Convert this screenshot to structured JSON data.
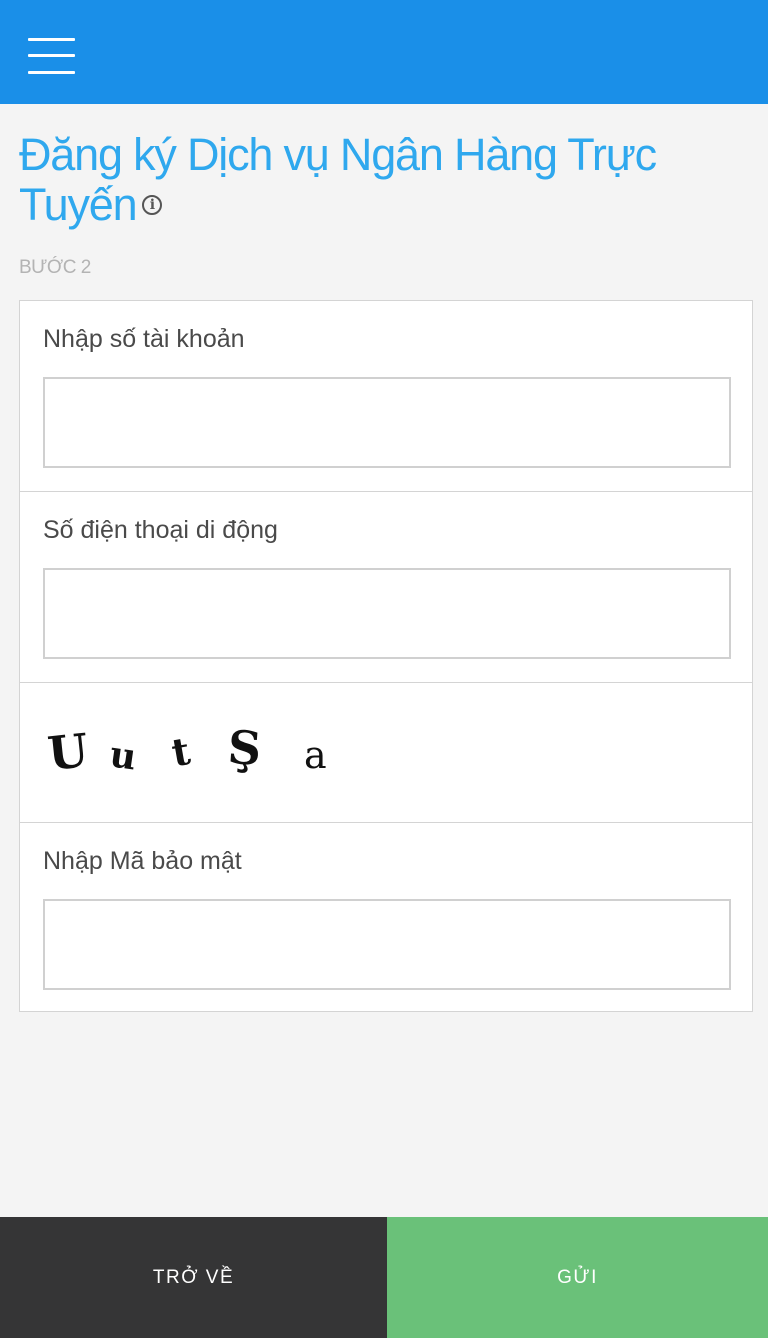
{
  "header": {
    "menu_icon": "hamburger-menu-icon",
    "bar_color": "#1a8fe8"
  },
  "page": {
    "title": "Đăng ký Dịch vụ Ngân Hàng Trực Tuyến",
    "info_icon": "info-icon",
    "step_label": "BƯỚC 2"
  },
  "form": {
    "account_number": {
      "label": "Nhập số tài khoản",
      "value": ""
    },
    "mobile_phone": {
      "label": "Số điện thoại di động",
      "value": ""
    },
    "captcha": {
      "characters": [
        "U",
        "u",
        "t",
        "Ş",
        "a"
      ]
    },
    "security_code": {
      "label": "Nhập Mã bảo mật",
      "value": ""
    }
  },
  "footer": {
    "back_label": "TRỞ VỀ",
    "back_color": "#353536",
    "send_label": "GỬI",
    "send_color": "#6ac179"
  }
}
